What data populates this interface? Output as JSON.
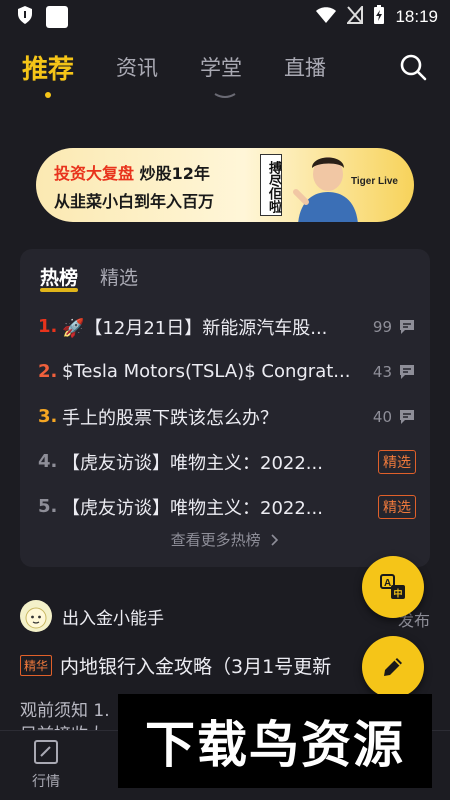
{
  "status_bar": {
    "time": "18:19"
  },
  "nav": {
    "tabs": [
      {
        "label": "推荐",
        "active": true
      },
      {
        "label": "资讯",
        "active": false
      },
      {
        "label": "学堂",
        "active": false
      },
      {
        "label": "直播",
        "active": false
      }
    ]
  },
  "banner": {
    "highlight": "投资大复盘",
    "line1_rest": "炒股12年",
    "line2": "从韭菜小白到年入百万",
    "sign": "搏尽佢啦",
    "brand": "Tiger Live"
  },
  "hot": {
    "tabs": [
      {
        "label": "热榜",
        "active": true
      },
      {
        "label": "精选",
        "active": false
      }
    ],
    "items": [
      {
        "rank": "1.",
        "title": "🚀【12月21日】新能源汽车股...",
        "count": "99",
        "badge": ""
      },
      {
        "rank": "2.",
        "title": "$Tesla Motors(TSLA)$ Congrat...",
        "count": "43",
        "badge": ""
      },
      {
        "rank": "3.",
        "title": "手上的股票下跌该怎么办？",
        "count": "40",
        "badge": ""
      },
      {
        "rank": "4.",
        "title": "【虎友访谈】唯物主义：2022...",
        "count": "",
        "badge": "精选"
      },
      {
        "rank": "5.",
        "title": "【虎友访谈】唯物主义：2022...",
        "count": "",
        "badge": "精选"
      }
    ],
    "more": "查看更多热榜"
  },
  "feed": {
    "author": "出入金小能手",
    "publish_tail": "发布",
    "tag": "精华",
    "title": "内地银行入金攻略（3月1号更新",
    "excerpt": "观前须知 1.",
    "excerpt2": "目前接收大"
  },
  "bottom_nav": {
    "item1": "行情"
  },
  "watermark": "下载鸟资源",
  "colors": {
    "accent": "#f5c518",
    "rank1": "#e8331c",
    "rank2": "#f0603c",
    "rank3": "#f5a623",
    "rank_other": "#8e8e98"
  }
}
